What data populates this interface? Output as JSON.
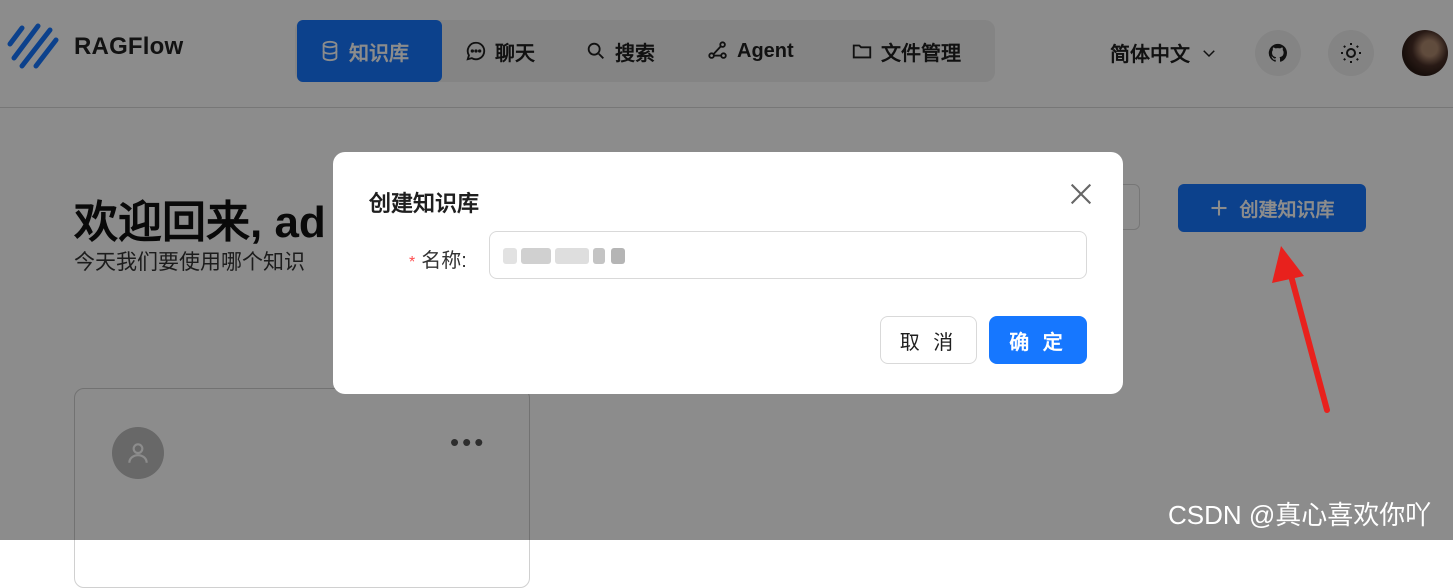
{
  "header": {
    "brand": "RAGFlow",
    "nav": [
      {
        "label": "知识库",
        "icon": "database-icon",
        "active": true
      },
      {
        "label": "聊天",
        "icon": "chat-icon",
        "active": false
      },
      {
        "label": "搜索",
        "icon": "search-icon",
        "active": false
      },
      {
        "label": "Agent",
        "icon": "agent-graph-icon",
        "active": false
      },
      {
        "label": "文件管理",
        "icon": "folder-icon",
        "active": false
      }
    ],
    "language": "简体中文",
    "accent": "#1677ff"
  },
  "page": {
    "welcome": "欢迎回来, ad",
    "subtitle": "今天我们要使用哪个知识",
    "create_button": "创建知识库"
  },
  "modal": {
    "title": "创建知识库",
    "field_label": "名称:",
    "required_mark": "*",
    "cancel_label": "取 消",
    "ok_label": "确 定"
  },
  "watermark": "CSDN @真心喜欢你吖"
}
